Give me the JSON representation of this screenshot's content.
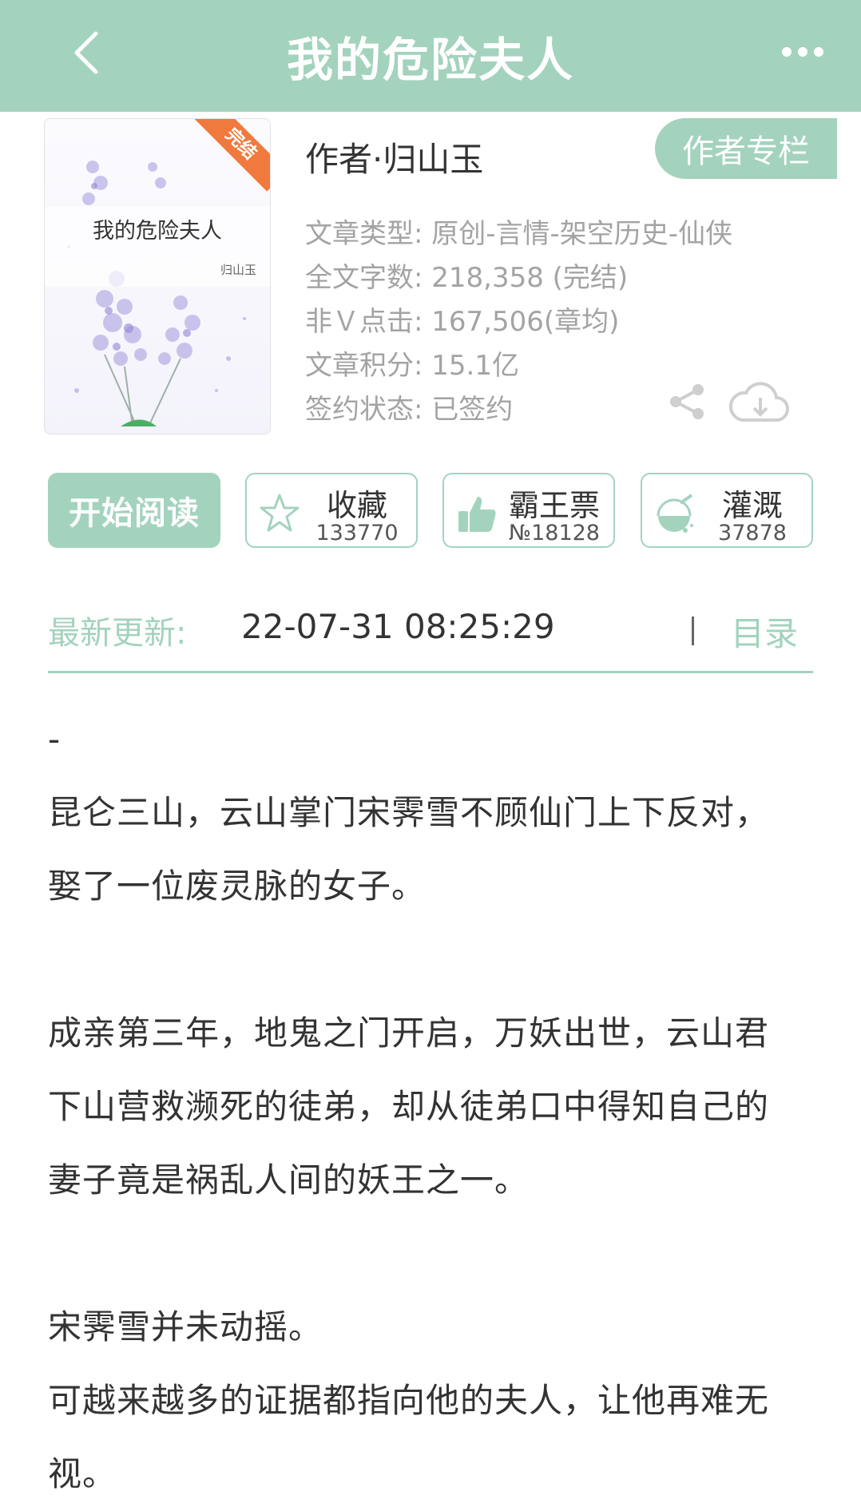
{
  "header": {
    "title": "我的危险夫人",
    "back_icon": "chevron-left-icon",
    "more_icon": "more-dots-icon"
  },
  "cover": {
    "title": "我的危险夫人",
    "author": "归山玉",
    "badge": "完结"
  },
  "book": {
    "author_line": "作者·归山玉",
    "author_column_label": "作者专栏",
    "meta": [
      "文章类型: 原创-言情-架空历史-仙侠",
      "全文字数: 218,358 (完结)",
      "非Ｖ点击: 167,506(章均)",
      "文章积分: 15.1亿",
      "签约状态: 已签约"
    ],
    "share_icon": "share-icon",
    "download_icon": "cloud-download-icon"
  },
  "actions": {
    "read_label": "开始阅读",
    "favorite": {
      "label": "收藏",
      "value": "133770",
      "icon": "star-icon"
    },
    "vote": {
      "label": "霸王票",
      "value": "№18128",
      "icon": "thumbs-up-icon"
    },
    "nutrient": {
      "label": "灌溉",
      "value": "37878",
      "icon": "nutrient-bottle-icon"
    }
  },
  "update": {
    "label": "最新更新:",
    "time": "22-07-31 08:25:29",
    "toc_label": "目录"
  },
  "synopsis": {
    "lines": [
      "-",
      "昆仑三山，云山掌门宋霁雪不顾仙门上下反对，",
      "娶了一位废灵脉的女子。",
      "",
      "成亲第三年，地鬼之门开启，万妖出世，云山君",
      "下山营救濒死的徒弟，却从徒弟口中得知自己的",
      "妻子竟是祸乱人间的妖王之一。",
      "",
      "宋霁雪并未动摇。",
      "可越来越多的证据都指向他的夫人，让他再难无",
      "视。"
    ]
  },
  "colors": {
    "accent": "#a3d3bd",
    "badge": "#f07a3e",
    "meta_text": "#a3a3a3"
  }
}
